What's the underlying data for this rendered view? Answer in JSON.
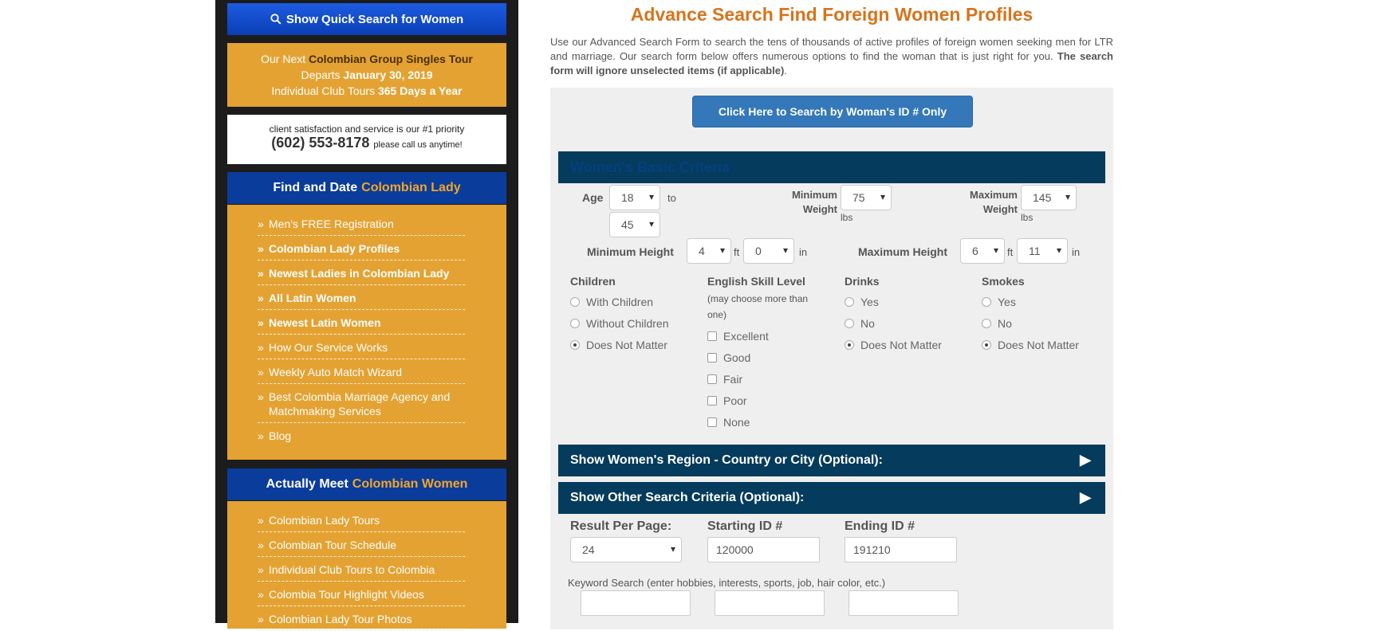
{
  "sidebar": {
    "quick_search": "Show Quick Search for Women",
    "tour": {
      "line1_prefix": "Our Next",
      "line1_highlight": "Colombian Group Singles Tour",
      "line2_prefix": "Departs",
      "line2_date": "January 30, 2019",
      "line3_prefix": "Individual Club Tours",
      "line3_bold": "365 Days a Year"
    },
    "phone": {
      "tagline": "client satisfaction and service is our #1 priority",
      "number": "(602) 553-8178",
      "call": "please call us anytime!"
    },
    "section1": {
      "title_white": "Find and Date",
      "title_orange": "Colombian Lady",
      "items": [
        {
          "label": "Men's FREE Registration"
        },
        {
          "label": "Colombian Lady Profiles"
        },
        {
          "label": "Newest Ladies in Colombian Lady"
        },
        {
          "label": "All Latin Women"
        },
        {
          "label": "Newest Latin Women"
        },
        {
          "label": "How Our Service Works"
        },
        {
          "label": "Weekly Auto Match Wizard"
        },
        {
          "label": "Best Colombia Marriage Agency and Matchmaking Services"
        },
        {
          "label": "Blog"
        }
      ]
    },
    "section2": {
      "title_white": "Actually Meet",
      "title_orange": "Colombian Women",
      "items": [
        {
          "label": "Colombian Lady Tours"
        },
        {
          "label": "Colombian Tour Schedule"
        },
        {
          "label": "Individual Club Tours to Colombia"
        },
        {
          "label": "Colombia Tour Highlight Videos"
        },
        {
          "label": "Colombian Lady Tour Photos"
        }
      ]
    }
  },
  "main": {
    "title": "Advance Search Find Foreign Women Profiles",
    "intro": "Use our Advanced Search Form to search the tens of thousands of active profiles of foreign women seeking men for LTR and marriage. Our search form below offers numerous options to find the woman that is just right for you.",
    "intro_bold": "The search form will ignore unselected items (if applicable)",
    "intro_end": ".",
    "id_button": "Click Here to Search by Woman's ID # Only",
    "basic_bar": "Women's Basic Criteria",
    "age": {
      "label": "Age",
      "from": "18",
      "to_word": "to",
      "to": "45"
    },
    "min_weight": {
      "label1": "Minimum",
      "label2": "Weight",
      "value": "75",
      "unit": "lbs"
    },
    "max_weight": {
      "label1": "Maximum",
      "label2": "Weight",
      "value": "145",
      "unit": "lbs"
    },
    "min_height": {
      "label": "Minimum Height",
      "ft": "4",
      "ft_unit": "ft",
      "in": "0",
      "in_unit": "in"
    },
    "max_height": {
      "label": "Maximum Height",
      "ft": "6",
      "ft_unit": "ft",
      "in": "11",
      "in_unit": "in"
    },
    "children": {
      "title": "Children",
      "options": [
        "With Children",
        "Without Children",
        "Does Not Matter"
      ]
    },
    "english": {
      "title": "English Skill Level",
      "note": "(may choose more than one)",
      "options": [
        "Excellent",
        "Good",
        "Fair",
        "Poor",
        "None"
      ]
    },
    "drinks": {
      "title": "Drinks",
      "options": [
        "Yes",
        "No",
        "Does Not Matter"
      ]
    },
    "smokes": {
      "title": "Smokes",
      "options": [
        "Yes",
        "No",
        "Does Not Matter"
      ]
    },
    "region_bar": "Show Women's Region - Country or City (Optional):",
    "other_bar": "Show Other Search Criteria (Optional):",
    "arrow": "▶",
    "result_per_page": {
      "label": "Result Per Page:",
      "value": "24"
    },
    "starting_id": {
      "label": "Starting ID #",
      "value": "120000"
    },
    "ending_id": {
      "label": "Ending ID #",
      "value": "191210"
    },
    "keyword_label": "Keyword Search (enter hobbies, interests, sports, job, hair color, etc.)",
    "keyword_values": [
      "",
      "",
      ""
    ]
  }
}
